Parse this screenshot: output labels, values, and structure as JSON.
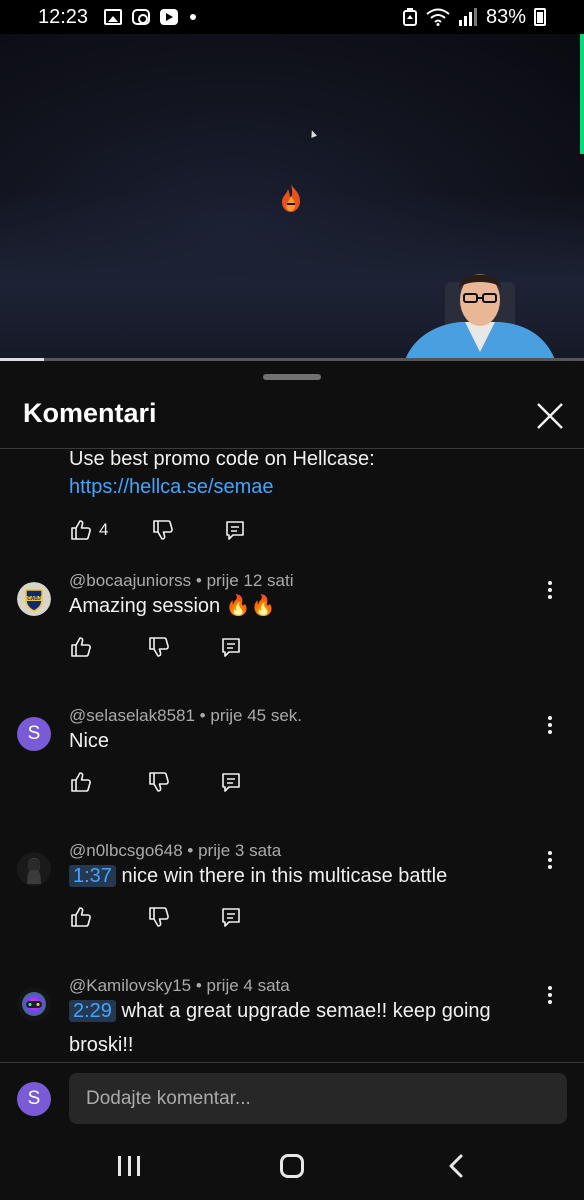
{
  "status_bar": {
    "time": "12:23",
    "battery": "83%",
    "icons": [
      "gallery-icon",
      "instagram-icon",
      "youtube-icon",
      "notification-dot",
      "recycle-icon",
      "wifi-icon",
      "signal-icon",
      "battery-icon"
    ]
  },
  "video": {
    "progress": 0.075,
    "progress_color": "#dddddd"
  },
  "sheet": {
    "title": "Komentari",
    "close_icon": "close-icon"
  },
  "pinned_comment": {
    "text": "Use best promo code on Hellcase:",
    "link": "https://hellca.se/semae",
    "likes": "4"
  },
  "comments": [
    {
      "avatar": "boca-juniors-crest",
      "author": "@bocaajuniorss",
      "time": "prije 12 sati",
      "text": "Amazing session",
      "emoji": "🔥🔥"
    },
    {
      "avatar_letter": "S",
      "author": "@selaselak8581",
      "time": "prije 45 sek.",
      "text": "Nice"
    },
    {
      "avatar": "dark-figure-avatar",
      "author": "@n0lbcsgo648",
      "time": "prije 3 sata",
      "timestamp": "1:37",
      "text": " nice win there in this multicase battle"
    },
    {
      "avatar": "colorful-controller-avatar",
      "author": "@Kamilovsky15",
      "time": "prije 4 sata",
      "timestamp": "2:29",
      "text": " what a great upgrade semae!! keep going broski!!"
    }
  ],
  "input": {
    "avatar_letter": "S",
    "placeholder": "Dodajte komentar..."
  },
  "colors": {
    "background": "#0f0f0f",
    "link": "#3ea6ff",
    "meta": "#aaaaaa",
    "avatar_purple": "#7a5bd6",
    "input_bg": "#272727"
  }
}
